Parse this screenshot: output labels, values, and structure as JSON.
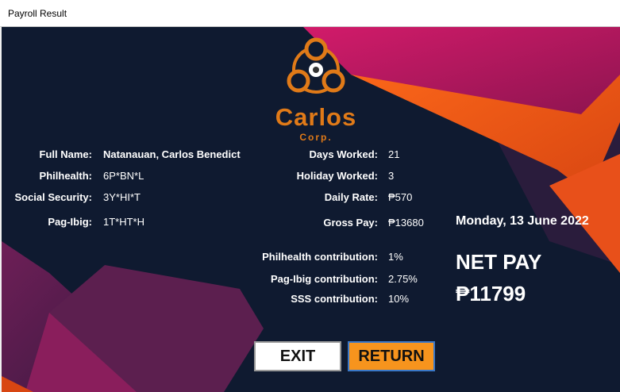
{
  "window": {
    "title": "Payroll Result"
  },
  "brand": {
    "name": "Carlos",
    "sub": "Corp."
  },
  "employee": {
    "full_name_label": "Full Name:",
    "full_name": "Natanauan, Carlos Benedict",
    "philhealth_label": "Philhealth:",
    "philhealth": "6P*BN*L",
    "sss_label": "Social Security:",
    "sss": "3Y*HI*T",
    "pagibig_label": "Pag-Ibig:",
    "pagibig": "1T*HT*H"
  },
  "work": {
    "days_worked_label": "Days Worked:",
    "days_worked": "21",
    "holiday_worked_label": "Holiday Worked:",
    "holiday_worked": "3",
    "daily_rate_label": "Daily Rate:",
    "daily_rate": "₱570",
    "gross_pay_label": "Gross Pay:",
    "gross_pay": "₱13680"
  },
  "contributions": {
    "philhealth_label": "Philhealth contribution:",
    "philhealth": "1%",
    "pagibig_label": "Pag-Ibig contribution:",
    "pagibig": "2.75%",
    "sss_label": "SSS contribution:",
    "sss": "10%"
  },
  "summary": {
    "date": "Monday, 13 June 2022",
    "net_pay_label": "NET PAY",
    "net_pay": "₱11799"
  },
  "buttons": {
    "exit": "EXIT",
    "return": "RETURN"
  },
  "colors": {
    "accent": "#f7941d",
    "background": "#0f1a30",
    "magenta": "#b0175a"
  }
}
